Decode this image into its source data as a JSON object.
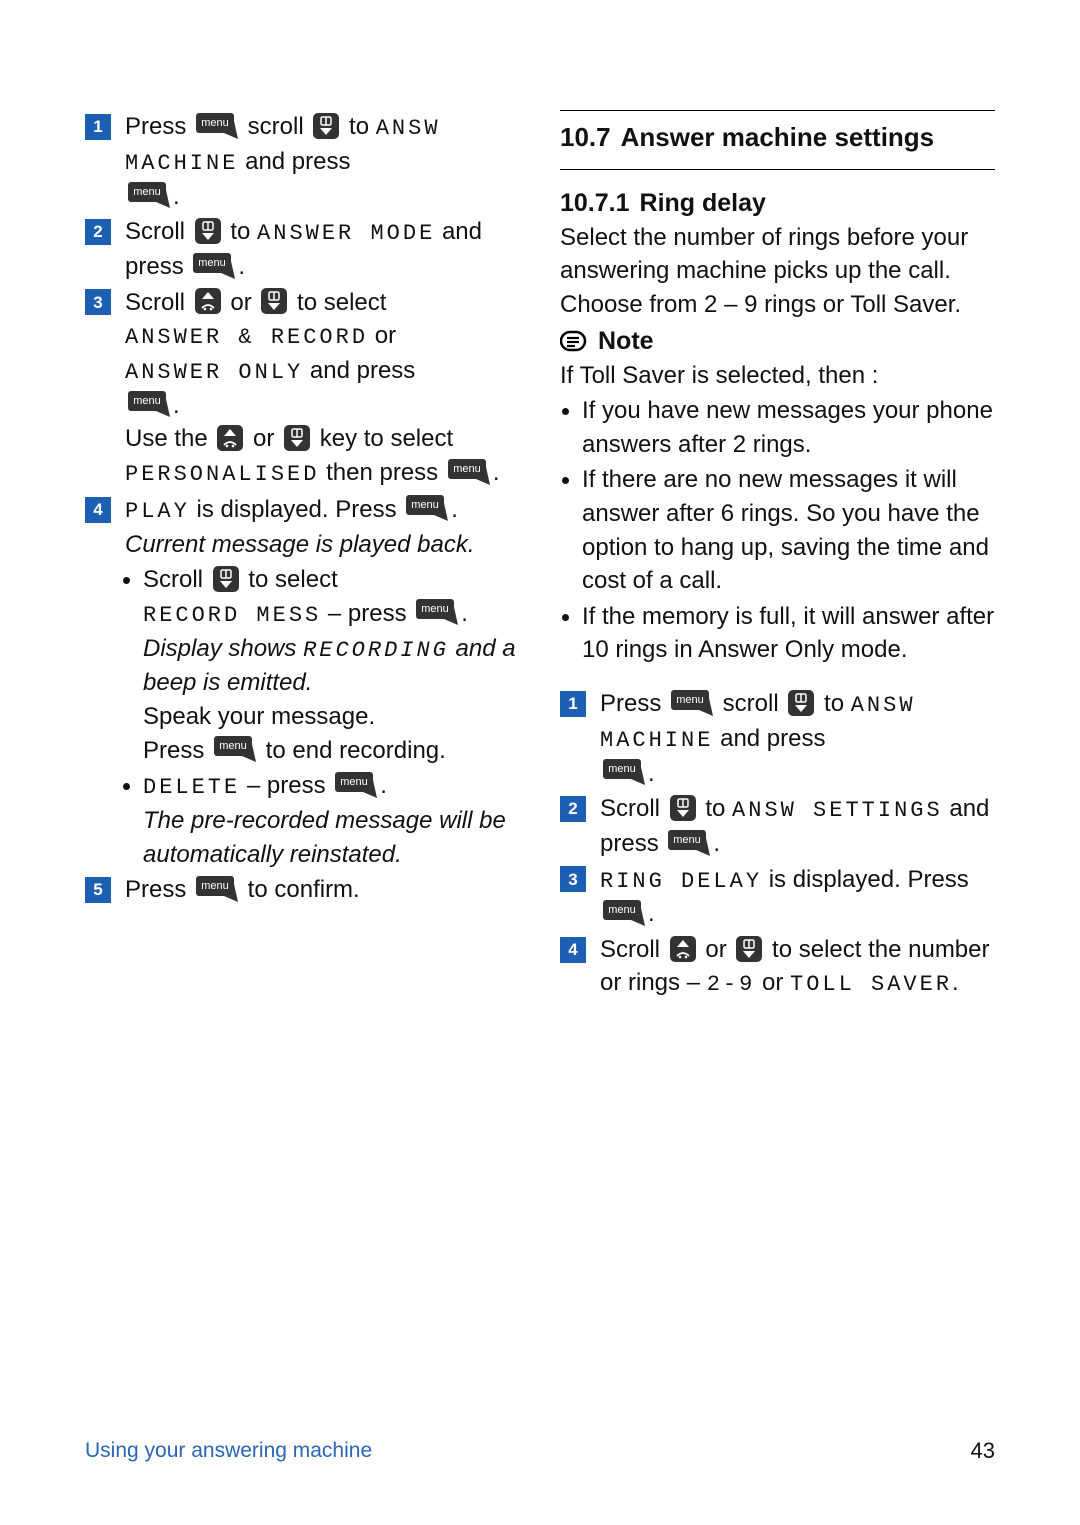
{
  "left": {
    "steps": [
      {
        "n": "1",
        "pre": "Press ",
        "mid1": " scroll ",
        "mid2": " to ",
        "lcd1": "ANSW MACHINE",
        "post1": " and press "
      },
      {
        "n": "2",
        "pre": "Scroll ",
        "mid1": " to ",
        "lcd1": "ANSWER MODE",
        "post1": " and press "
      },
      {
        "n": "3",
        "line1_pre": "Scroll ",
        "line1_mid": " or ",
        "line1_post": " to select ",
        "line2_lcd1": "ANSWER & RECORD",
        "line2_mid": " or ",
        "line3_lcd1": "ANSWER ONLY",
        "line3_post": " and press ",
        "use_pre": "Use the ",
        "use_mid": " or ",
        "use_post": " key to select ",
        "use_lcd": "PERSONALISED",
        "use_then": " then press "
      },
      {
        "n": "4",
        "line1_lcd": "PLAY",
        "line1_txt": " is displayed. Press ",
        "it1": "Current message is played back.",
        "b1_pre": "Scroll ",
        "b1_mid": " to select ",
        "b1_lcd": "RECORD MESS",
        "b1_dash": " – press ",
        "b1_it": "Display shows ",
        "b1_it_lcd": "RECORDING",
        "b1_it2": " and a beep is emitted.",
        "b1_speak": "Speak your message.",
        "b1_press": "Press ",
        "b1_end": " to end recording.",
        "b2_lcd": "DELETE",
        "b2_dash": " – press ",
        "b2_it": "The pre-recorded message will be automatically reinstated."
      },
      {
        "n": "5",
        "pre": "Press ",
        "post": " to confirm."
      }
    ]
  },
  "right": {
    "h2_num": "10.7",
    "h2_txt": "Answer machine settings",
    "h3_num": "10.7.1",
    "h3_txt": "Ring delay",
    "intro": "Select the number of rings before your answering machine picks up the call. Choose from 2 – 9 rings or Toll Saver.",
    "note_label": "Note",
    "note_intro": "If Toll Saver is selected, then :",
    "note_bullets": [
      "If you have new messages your phone answers after 2 rings.",
      "If there are no new messages it will answer after 6 rings. So you have the option to hang up, saving the time and cost of a call.",
      "If the memory is full, it will answer after 10 rings in Answer Only mode."
    ],
    "steps": [
      {
        "n": "1",
        "pre": "Press ",
        "mid1": " scroll ",
        "mid2": " to ",
        "lcd1": "ANSW MACHINE",
        "post1": " and press "
      },
      {
        "n": "2",
        "pre": "Scroll ",
        "mid1": " to ",
        "lcd1": "ANSW SETTINGS",
        "post1": " and press "
      },
      {
        "n": "3",
        "lcd1": "RING DELAY",
        "txt": " is displayed. Press "
      },
      {
        "n": "4",
        "pre": "Scroll ",
        "mid": " or ",
        "post": " to select the number or rings – ",
        "lcd1": "2-9",
        "or": " or ",
        "lcd2": "TOLL SAVER",
        "dot": "."
      }
    ]
  },
  "footer": {
    "left": "Using your answering machine",
    "page": "43"
  }
}
